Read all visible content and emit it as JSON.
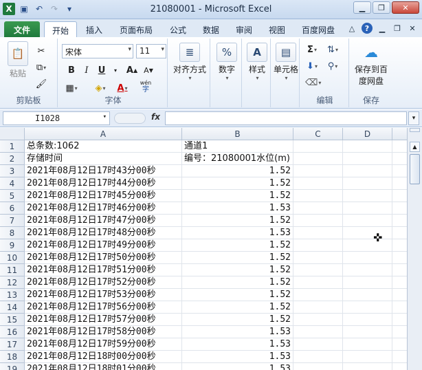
{
  "window": {
    "title": "21080001  -  Microsoft Excel",
    "qat_icons": [
      "save-icon",
      "undo-icon",
      "redo-icon",
      "customize-qat-icon"
    ]
  },
  "tabs": [
    {
      "label": "文件"
    },
    {
      "label": "开始"
    },
    {
      "label": "插入"
    },
    {
      "label": "页面布局"
    },
    {
      "label": "公式"
    },
    {
      "label": "数据"
    },
    {
      "label": "审阅"
    },
    {
      "label": "视图"
    },
    {
      "label": "百度网盘"
    }
  ],
  "ribbon": {
    "clipboard": {
      "paste": "粘贴",
      "label": "剪贴板"
    },
    "font": {
      "name": "宋体",
      "size": "11",
      "bold": "B",
      "italic": "I",
      "underline": "U",
      "label": "字体",
      "grow": "A",
      "shrink": "A",
      "wen": "wén"
    },
    "alignment": {
      "label": "对齐方式"
    },
    "number": {
      "label": "数字",
      "percent": "%"
    },
    "styles": {
      "label": "样式"
    },
    "cells": {
      "label": "单元格"
    },
    "editing": {
      "label": "编辑",
      "sum": "Σ"
    },
    "save": {
      "button": "保存到百度网盘",
      "line1": "保存到百",
      "line2": "度网盘",
      "label": "保存"
    }
  },
  "formula_bar": {
    "name_box": "I1028",
    "fx": "fx",
    "content": ""
  },
  "columns": [
    "A",
    "B",
    "C",
    "D"
  ],
  "rows": [
    {
      "n": "1",
      "a": "总条数:1062",
      "b": "通道1"
    },
    {
      "n": "2",
      "a": "存储时间",
      "b": "编号：21080001水位(m)"
    },
    {
      "n": "3",
      "a": "2021年08月12日17时43分00秒",
      "b": "1.52"
    },
    {
      "n": "4",
      "a": "2021年08月12日17时44分00秒",
      "b": "1.52"
    },
    {
      "n": "5",
      "a": "2021年08月12日17时45分00秒",
      "b": "1.52"
    },
    {
      "n": "6",
      "a": "2021年08月12日17时46分00秒",
      "b": "1.53"
    },
    {
      "n": "7",
      "a": "2021年08月12日17时47分00秒",
      "b": "1.52"
    },
    {
      "n": "8",
      "a": "2021年08月12日17时48分00秒",
      "b": "1.53"
    },
    {
      "n": "9",
      "a": "2021年08月12日17时49分00秒",
      "b": "1.52"
    },
    {
      "n": "10",
      "a": "2021年08月12日17时50分00秒",
      "b": "1.52"
    },
    {
      "n": "11",
      "a": "2021年08月12日17时51分00秒",
      "b": "1.52"
    },
    {
      "n": "12",
      "a": "2021年08月12日17时52分00秒",
      "b": "1.52"
    },
    {
      "n": "13",
      "a": "2021年08月12日17时53分00秒",
      "b": "1.52"
    },
    {
      "n": "14",
      "a": "2021年08月12日17时56分00秒",
      "b": "1.52"
    },
    {
      "n": "15",
      "a": "2021年08月12日17时57分00秒",
      "b": "1.52"
    },
    {
      "n": "16",
      "a": "2021年08月12日17时58分00秒",
      "b": "1.53"
    },
    {
      "n": "17",
      "a": "2021年08月12日17时59分00秒",
      "b": "1.53"
    },
    {
      "n": "18",
      "a": "2021年08月12日18时00分00秒",
      "b": "1.53"
    },
    {
      "n": "19",
      "a": "2021年08月12日18时01分00秒",
      "b": "1.53"
    }
  ]
}
